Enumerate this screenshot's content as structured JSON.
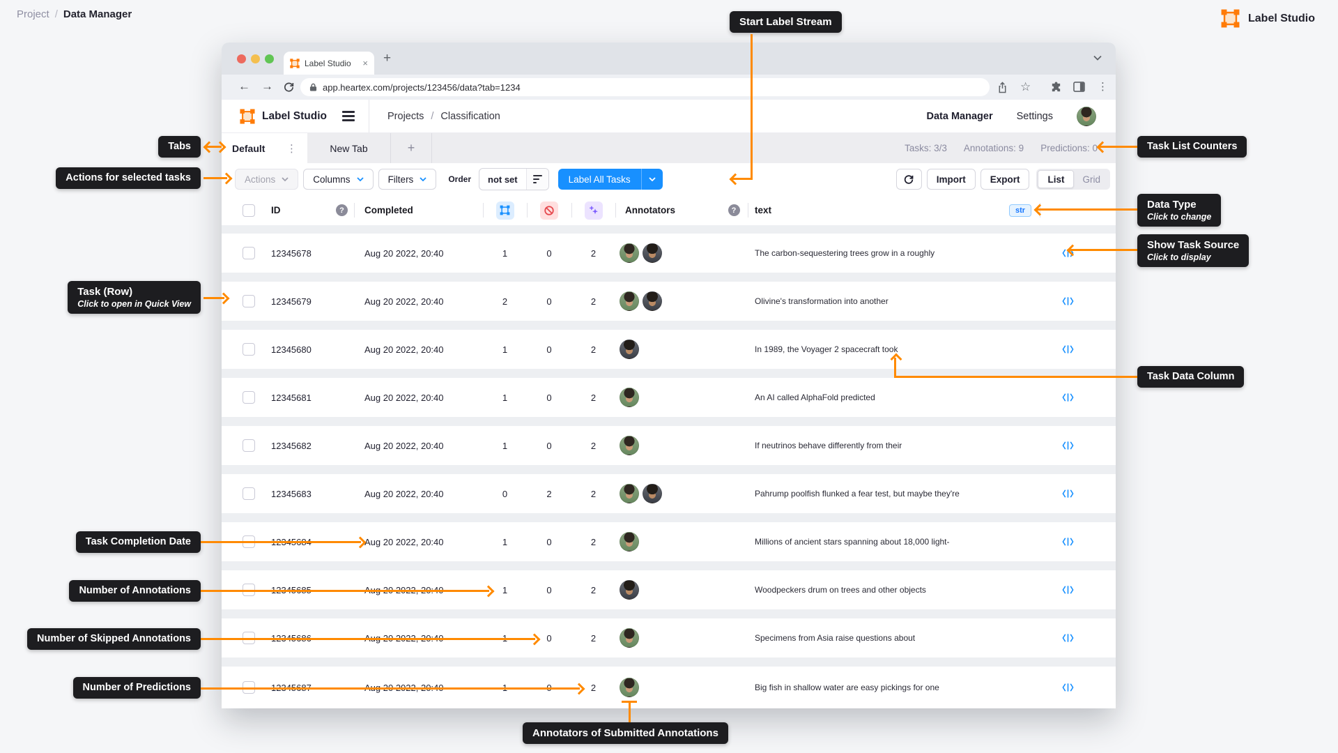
{
  "page": {
    "breadcrumb": {
      "project": "Project",
      "separator": "/",
      "current": "Data Manager"
    },
    "brand": "Label Studio"
  },
  "browser": {
    "tab_title": "Label Studio",
    "url": "app.heartex.com/projects/123456/data?tab=1234"
  },
  "app": {
    "header": {
      "brand": "Label Studio",
      "nav_projects": "Projects",
      "nav_separator": "/",
      "nav_page": "Classification",
      "menu_data_manager": "Data Manager",
      "menu_settings": "Settings"
    },
    "tabs": {
      "active": "Default",
      "inactive": "New Tab"
    },
    "counters": {
      "tasks": "Tasks: 3/3",
      "annotations": "Annotations: 9",
      "predictions": "Predictions: 0"
    },
    "toolbar": {
      "actions": "Actions",
      "columns": "Columns",
      "filters": "Filters",
      "order_label": "Order",
      "order_value": "not set",
      "label_all": "Label All Tasks",
      "import": "Import",
      "export": "Export",
      "view_list": "List",
      "view_grid": "Grid"
    },
    "table": {
      "columns": {
        "id": "ID",
        "completed": "Completed",
        "annotators": "Annotators",
        "text": "text",
        "type_badge": "str"
      },
      "rows": [
        {
          "id": "12345678",
          "completed": "Aug 20 2022, 20:40",
          "annotations": "1",
          "skipped": "0",
          "predictions": "2",
          "annotators": [
            "woman",
            "man"
          ],
          "text": "The carbon-sequestering trees grow in a roughly"
        },
        {
          "id": "12345679",
          "completed": "Aug 20 2022, 20:40",
          "annotations": "2",
          "skipped": "0",
          "predictions": "2",
          "annotators": [
            "woman",
            "man"
          ],
          "text": "Olivine's transformation into another"
        },
        {
          "id": "12345680",
          "completed": "Aug 20 2022, 20:40",
          "annotations": "1",
          "skipped": "0",
          "predictions": "2",
          "annotators": [
            "man"
          ],
          "text": "In 1989, the Voyager 2 spacecraft took"
        },
        {
          "id": "12345681",
          "completed": "Aug 20 2022, 20:40",
          "annotations": "1",
          "skipped": "0",
          "predictions": "2",
          "annotators": [
            "woman"
          ],
          "text": "An AI called AlphaFold predicted"
        },
        {
          "id": "12345682",
          "completed": "Aug 20 2022, 20:40",
          "annotations": "1",
          "skipped": "0",
          "predictions": "2",
          "annotators": [
            "woman"
          ],
          "text": "If neutrinos behave differently from their"
        },
        {
          "id": "12345683",
          "completed": "Aug 20 2022, 20:40",
          "annotations": "0",
          "skipped": "2",
          "predictions": "2",
          "annotators": [
            "woman",
            "man"
          ],
          "text": "Pahrump poolfish flunked a fear test, but maybe they're"
        },
        {
          "id": "12345684",
          "completed": "Aug 20 2022, 20:40",
          "annotations": "1",
          "skipped": "0",
          "predictions": "2",
          "annotators": [
            "woman"
          ],
          "text": "Millions of ancient stars spanning about 18,000 light-"
        },
        {
          "id": "12345685",
          "completed": "Aug 20 2022, 20:40",
          "annotations": "1",
          "skipped": "0",
          "predictions": "2",
          "annotators": [
            "man"
          ],
          "text": "Woodpeckers drum on trees and other objects"
        },
        {
          "id": "12345686",
          "completed": "Aug 20 2022, 20:40",
          "annotations": "1",
          "skipped": "0",
          "predictions": "2",
          "annotators": [
            "woman"
          ],
          "text": "Specimens from Asia raise questions about"
        },
        {
          "id": "12345687",
          "completed": "Aug 20 2022, 20:40",
          "annotations": "1",
          "skipped": "0",
          "predictions": "2",
          "annotators": [
            "woman"
          ],
          "text": "Big fish in shallow water are easy pickings for one"
        }
      ]
    }
  },
  "callouts": {
    "start_label_stream": "Start Label Stream",
    "tabs": "Tabs",
    "actions": "Actions for selected tasks",
    "task_list_counters": "Task List Counters",
    "data_type": {
      "title": "Data Type",
      "subtitle": "Click to change"
    },
    "show_task_source": {
      "title": "Show Task Source",
      "subtitle": "Click to display"
    },
    "task_row": {
      "title": "Task (Row)",
      "subtitle": "Click to open in Quick View"
    },
    "task_data_column": "Task Data Column",
    "task_completion_date": "Task Completion Date",
    "number_of_annotations": "Number of Annotations",
    "number_of_skipped": "Number of Skipped Annotations",
    "number_of_predictions": "Number of Predictions",
    "annotators_submitted": "Annotators of Submitted Annotations"
  },
  "icons": {
    "annotations_column": "label-studio-square",
    "skipped_column": "cancel-circle",
    "predictions_column": "sparkles-plus",
    "task_source": "code-brackets",
    "help": "question-mark",
    "order_sort": "sort-bars",
    "refresh": "refresh-arrow"
  },
  "colors": {
    "accent_blue": "#1890FF",
    "callout_orange": "#FF8A00",
    "callout_bg": "#1D1D20",
    "brand_orange": "#FF7B07"
  }
}
